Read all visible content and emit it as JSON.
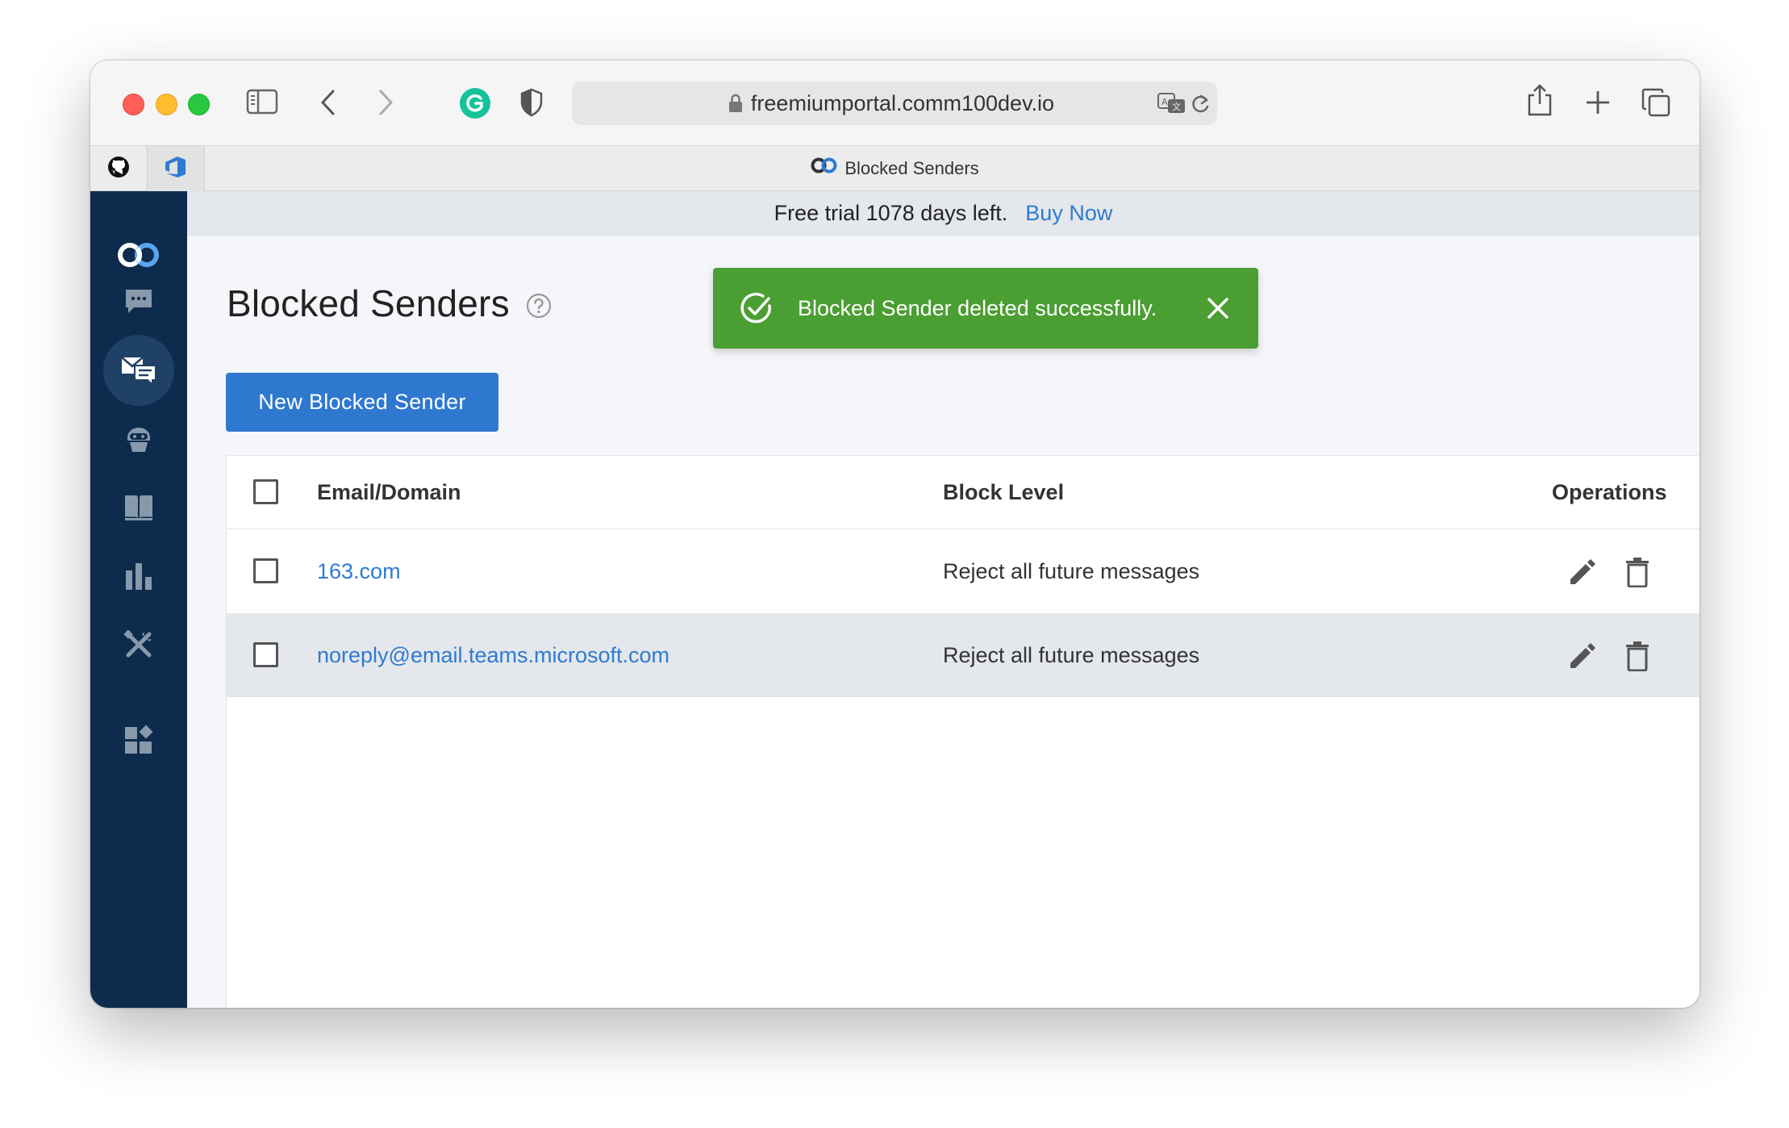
{
  "browser": {
    "url": "freemiumportal.comm100dev.io",
    "tab_title": "Blocked Senders"
  },
  "banner": {
    "text": "Free trial 1078 days left.",
    "link": "Buy Now"
  },
  "page": {
    "title": "Blocked Senders"
  },
  "toast": {
    "message": "Blocked Sender deleted successfully.",
    "color": "#4a9e32"
  },
  "actions": {
    "new_button": "New Blocked Sender"
  },
  "table": {
    "columns": [
      "Email/Domain",
      "Block Level",
      "Operations"
    ],
    "rows": [
      {
        "email": "163.com",
        "level": "Reject all future messages"
      },
      {
        "email": "noreply@email.teams.microsoft.com",
        "level": "Reject all future messages"
      }
    ]
  },
  "sidebar": {
    "items": [
      "logo-icon",
      "chat-icon",
      "email-ticket-icon",
      "bot-icon",
      "knowledge-base-icon",
      "reports-icon",
      "settings-tools-icon",
      "apps-icon"
    ],
    "active": "email-ticket-icon"
  },
  "colors": {
    "accent": "#2e78cf",
    "sidebar": "#0d2c4d",
    "link": "#2f7bd1"
  }
}
